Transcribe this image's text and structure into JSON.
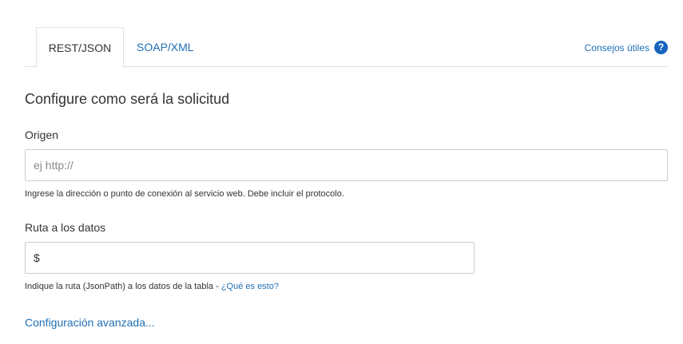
{
  "tabs": [
    {
      "label": "REST/JSON",
      "active": true
    },
    {
      "label": "SOAP/XML",
      "active": false
    }
  ],
  "help": {
    "label": "Consejos útiles",
    "icon": "question-circle-icon",
    "icon_glyph": "?"
  },
  "form": {
    "title": "Configure como será la solicitud",
    "origin": {
      "label": "Origen",
      "placeholder": "ej http://",
      "value": "",
      "hint": "Ingrese la dirección o punto de conexión al servicio web. Debe incluir el protocolo."
    },
    "data_path": {
      "label": "Ruta a los datos",
      "value": "$",
      "hint": "Indique la ruta (JsonPath) a los datos de la tabla - ",
      "hint_link": "¿Qué es esto?"
    },
    "advanced_link": "Configuración avanzada..."
  },
  "colors": {
    "link": "#1f6fb5",
    "help_icon_bg": "#1565c0",
    "border": "#cccccc",
    "text": "#333333"
  }
}
